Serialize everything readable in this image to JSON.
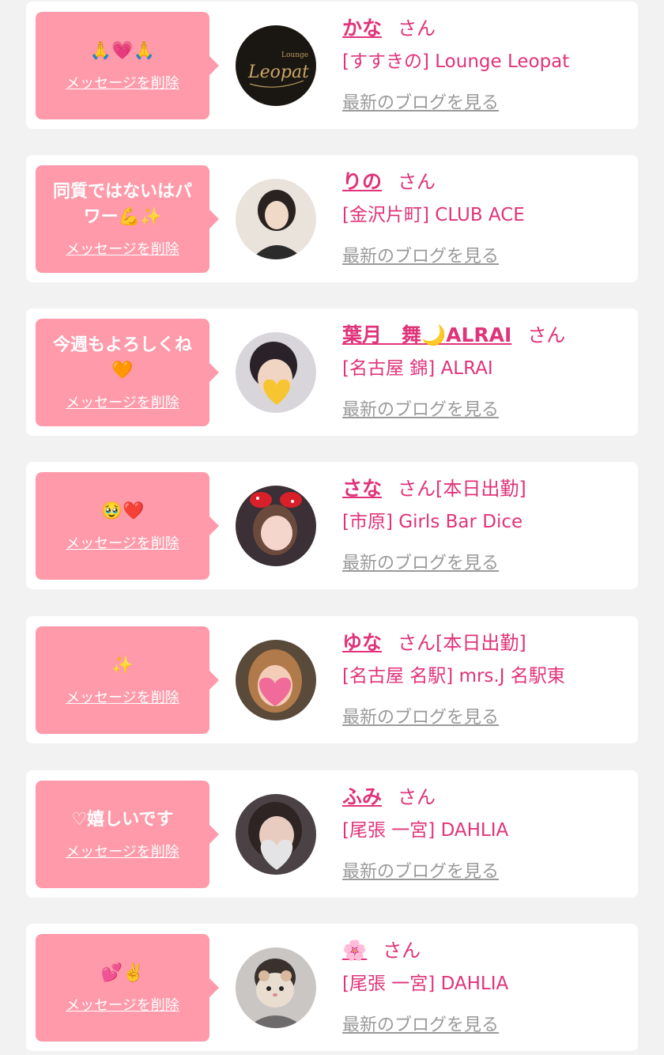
{
  "delete_label": "メッセージを削除",
  "blog_label": "最新のブログを見る",
  "colors": {
    "accent": "#e0337a",
    "bubble": "#fe9aaa",
    "background": "#f2f2f2",
    "muted": "#9a9a9a"
  },
  "cards": [
    {
      "message": "🙏💗🙏",
      "name": "かな",
      "suffix": "さん",
      "shop": "[すすきの] Lounge Leopat"
    },
    {
      "message": "同質ではないはパワー💪✨",
      "name": "りの",
      "suffix": "さん",
      "shop": "[金沢片町] CLUB ACE"
    },
    {
      "message": "今週もよろしくね🧡",
      "name": "葉月　舞🌙ALRAI",
      "suffix": "さん",
      "shop": "[名古屋 錦] ALRAI"
    },
    {
      "message": "🥹❤️",
      "name": "さな",
      "suffix": "さん[本日出勤]",
      "shop": "[市原] Girls Bar Dice"
    },
    {
      "message": "✨",
      "name": "ゆな",
      "suffix": "さん[本日出勤]",
      "shop": "[名古屋 名駅] mrs.J 名駅東"
    },
    {
      "message": "♡嬉しいです",
      "name": "ふみ",
      "suffix": "さん",
      "shop": "[尾張 一宮] DAHLIA"
    },
    {
      "message": "💕✌️",
      "name": "🌸",
      "suffix": "さん",
      "shop": "[尾張 一宮] DAHLIA"
    }
  ]
}
